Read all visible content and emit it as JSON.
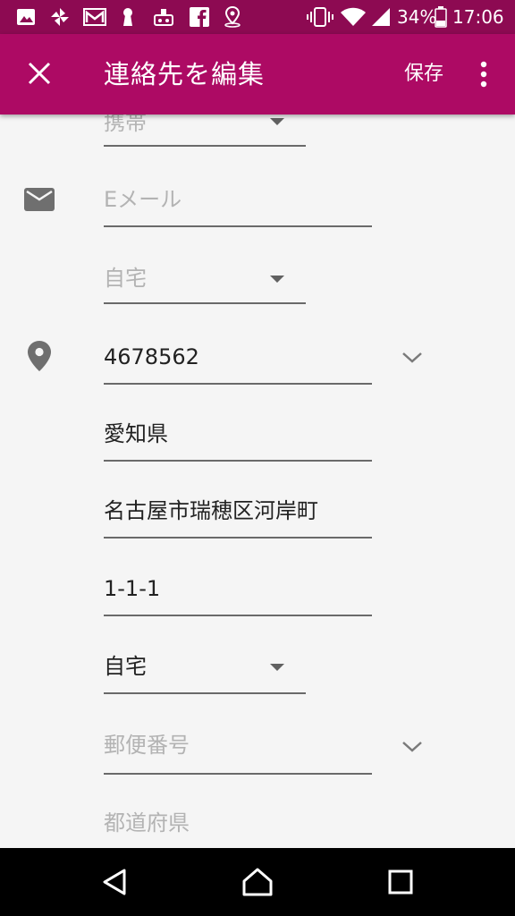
{
  "status_bar": {
    "icons": [
      "image-icon",
      "pinwheel-icon",
      "mail-icon",
      "keyhole-icon",
      "robot-icon",
      "facebook-icon",
      "location-pin-icon"
    ],
    "right_icons": [
      "vibrate-icon",
      "wifi-icon",
      "signal-icon",
      "battery-icon"
    ],
    "battery": "34%",
    "time": "17:06"
  },
  "app_bar": {
    "title": "連絡先を編集",
    "save_label": "保存",
    "close_icon": "close-icon",
    "more_icon": "more-vert-icon"
  },
  "form": {
    "phone_type": "携帯",
    "email_placeholder": "Eメール",
    "email_type": "自宅",
    "address": {
      "postal_code": "4678562",
      "prefecture": "愛知県",
      "city": "名古屋市瑞穂区河岸町",
      "street": "1-1-1",
      "type": "自宅"
    },
    "second_address": {
      "postal_code_placeholder": "郵便番号",
      "prefecture_placeholder": "都道府県"
    }
  },
  "colors": {
    "status_bar": "#8d0a52",
    "app_bar": "#ad0a64",
    "background": "#f5f5f5"
  },
  "nav_bar": {
    "icons": [
      "back-icon",
      "home-icon",
      "recents-icon"
    ]
  }
}
